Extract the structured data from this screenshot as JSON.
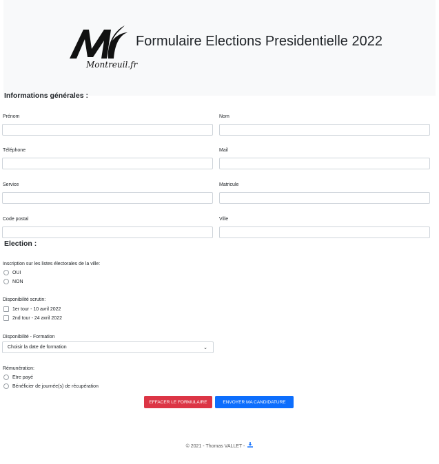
{
  "header": {
    "logo_text": "Montreuil.fr",
    "title": "Formulaire Elections Presidentielle 2022"
  },
  "section_general": "Informations générales :",
  "fields": {
    "prenom": "Prénom",
    "nom": "Nom",
    "telephone": "Téléphone",
    "mail": "Mail",
    "service": "Service",
    "matricule": "Matricule",
    "code_postal": "Code postal",
    "ville": "Ville"
  },
  "section_election": "Election :",
  "inscription": {
    "label": "Inscription sur les listes électorales de la ville:",
    "oui": "OUI",
    "non": "NON"
  },
  "disponibilite_scrutin": {
    "label": "Disponibilité scrutin:",
    "tour1": "1er tour - 10 avril 2022",
    "tour2": "2nd tour - 24 avril 2022"
  },
  "disponibilite_formation": {
    "label": "Disponibilité - Formation",
    "selected": "Choisir la date de formation"
  },
  "remuneration": {
    "label": "Rémunération:",
    "opt1": "Etre payé",
    "opt2": "Bénéficier de journée(s) de récupération"
  },
  "buttons": {
    "clear": "EFFACER LE FORMULAIRE",
    "send": "ENVOYER MA CANDIDATURE"
  },
  "footer": {
    "text": "© 2021 - Thomas VALLET - "
  },
  "colors": {
    "danger": "#dc3545",
    "primary": "#0d6efd",
    "header_bg": "#f8f9fa"
  }
}
